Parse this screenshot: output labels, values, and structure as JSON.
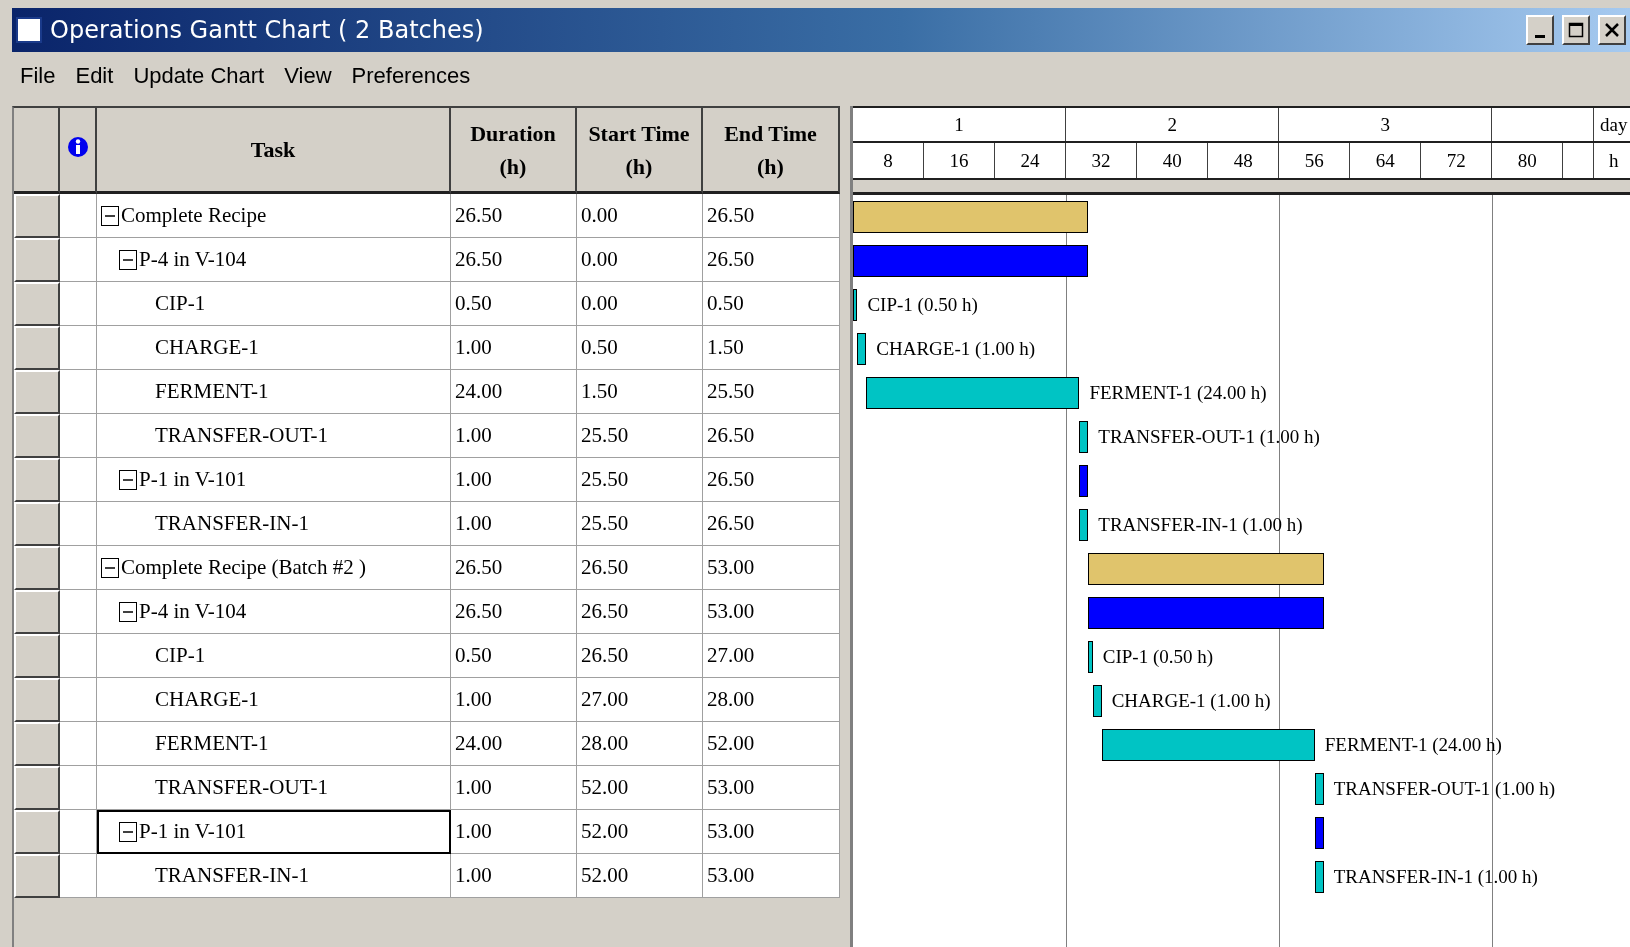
{
  "window": {
    "title": "Operations Gantt Chart ( 2 Batches)"
  },
  "menu": [
    "File",
    "Edit",
    "Update Chart",
    "View",
    "Preferences"
  ],
  "table": {
    "columns": [
      {
        "label": "Task"
      },
      {
        "label": "Duration",
        "unit": "(h)"
      },
      {
        "label": "Start Time",
        "unit": "(h)"
      },
      {
        "label": "End Time",
        "unit": "(h)"
      }
    ],
    "rows": [
      {
        "kind": "recipe",
        "task": "Complete Recipe",
        "duration": "26.50",
        "start": "0.00",
        "end": "26.50",
        "expanded": true,
        "selected": false,
        "children": [
          {
            "kind": "procedure",
            "task": "P-4 in V-104",
            "duration": "26.50",
            "start": "0.00",
            "end": "26.50",
            "expanded": true,
            "selected": false,
            "children": [
              {
                "kind": "operation",
                "task": "CIP-1",
                "duration": "0.50",
                "start": "0.00",
                "end": "0.50",
                "selected": false,
                "bar_label": "CIP-1 (0.50 h)"
              },
              {
                "kind": "operation",
                "task": "CHARGE-1",
                "duration": "1.00",
                "start": "0.50",
                "end": "1.50",
                "selected": false,
                "bar_label": "CHARGE-1 (1.00 h)"
              },
              {
                "kind": "operation",
                "task": "FERMENT-1",
                "duration": "24.00",
                "start": "1.50",
                "end": "25.50",
                "selected": false,
                "bar_label": "FERMENT-1 (24.00 h)"
              },
              {
                "kind": "operation",
                "task": "TRANSFER-OUT-1",
                "duration": "1.00",
                "start": "25.50",
                "end": "26.50",
                "selected": false,
                "bar_label": "TRANSFER-OUT-1 (1.00 h)"
              }
            ]
          },
          {
            "kind": "procedure",
            "task": "P-1 in V-101",
            "duration": "1.00",
            "start": "25.50",
            "end": "26.50",
            "expanded": true,
            "selected": false,
            "children": [
              {
                "kind": "operation",
                "task": "TRANSFER-IN-1",
                "duration": "1.00",
                "start": "25.50",
                "end": "26.50",
                "selected": false,
                "bar_label": "TRANSFER-IN-1 (1.00 h)"
              }
            ]
          }
        ]
      },
      {
        "kind": "recipe",
        "task": "Complete Recipe (Batch #2 )",
        "duration": "26.50",
        "start": "26.50",
        "end": "53.00",
        "expanded": true,
        "selected": false,
        "children": [
          {
            "kind": "procedure",
            "task": "P-4 in V-104",
            "duration": "26.50",
            "start": "26.50",
            "end": "53.00",
            "expanded": true,
            "selected": false,
            "children": [
              {
                "kind": "operation",
                "task": "CIP-1",
                "duration": "0.50",
                "start": "26.50",
                "end": "27.00",
                "selected": false,
                "bar_label": "CIP-1 (0.50 h)"
              },
              {
                "kind": "operation",
                "task": "CHARGE-1",
                "duration": "1.00",
                "start": "27.00",
                "end": "28.00",
                "selected": false,
                "bar_label": "CHARGE-1 (1.00 h)"
              },
              {
                "kind": "operation",
                "task": "FERMENT-1",
                "duration": "24.00",
                "start": "28.00",
                "end": "52.00",
                "selected": false,
                "bar_label": "FERMENT-1 (24.00 h)"
              },
              {
                "kind": "operation",
                "task": "TRANSFER-OUT-1",
                "duration": "1.00",
                "start": "52.00",
                "end": "53.00",
                "selected": false,
                "bar_label": "TRANSFER-OUT-1 (1.00 h)"
              }
            ]
          },
          {
            "kind": "procedure",
            "task": "P-1 in V-101",
            "duration": "1.00",
            "start": "52.00",
            "end": "53.00",
            "expanded": true,
            "selected": true,
            "children": [
              {
                "kind": "operation",
                "task": "TRANSFER-IN-1",
                "duration": "1.00",
                "start": "52.00",
                "end": "53.00",
                "selected": false,
                "bar_label": "TRANSFER-IN-1 (1.00 h)"
              }
            ]
          }
        ]
      }
    ]
  },
  "gantt": {
    "days": [
      "1",
      "2",
      "3"
    ],
    "day_unit": "day",
    "hours": [
      "8",
      "16",
      "24",
      "32",
      "40",
      "48",
      "56",
      "64",
      "72",
      "80"
    ],
    "hour_unit": "h"
  }
}
